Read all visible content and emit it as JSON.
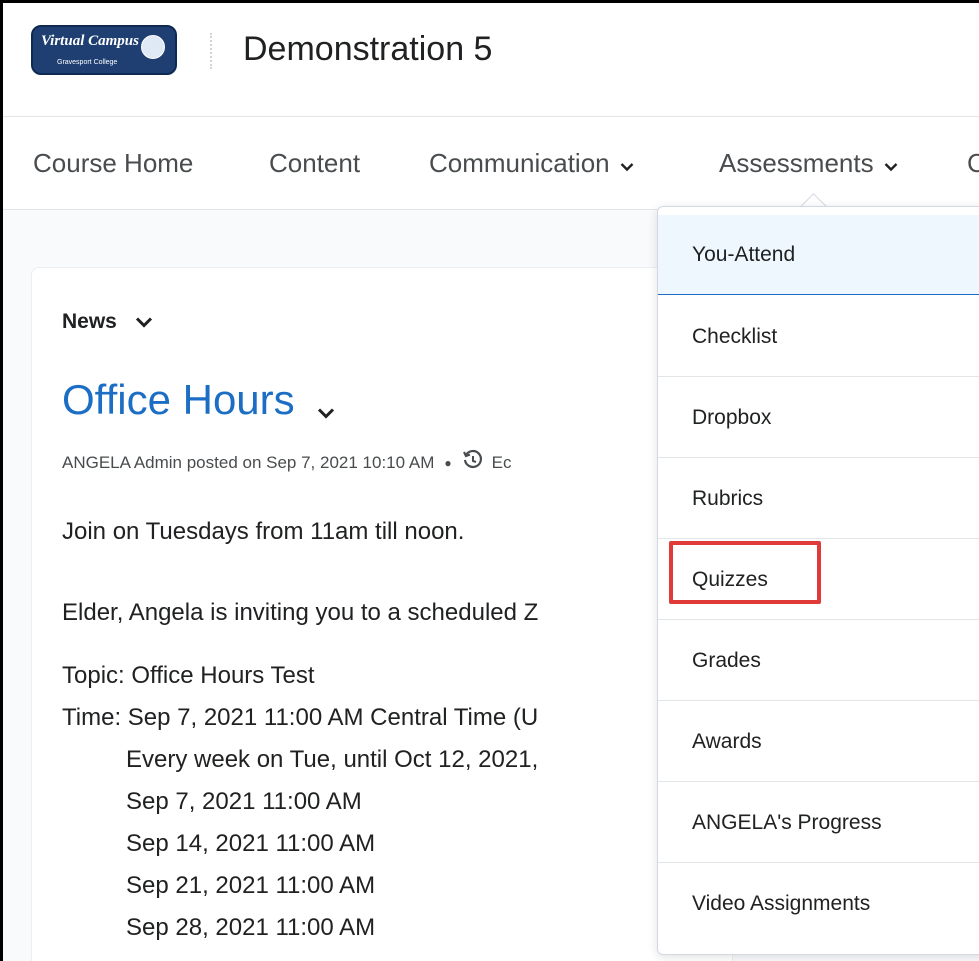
{
  "header": {
    "logo": {
      "text": "Virtual Campus",
      "subtext": "Gravesport College"
    },
    "course_title": "Demonstration 5"
  },
  "nav": {
    "items": [
      {
        "label": "Course Home",
        "has_dropdown": false
      },
      {
        "label": "Content",
        "has_dropdown": false
      },
      {
        "label": "Communication",
        "has_dropdown": true
      },
      {
        "label": "Assessments",
        "has_dropdown": true
      },
      {
        "label": "C",
        "has_dropdown": false
      }
    ]
  },
  "news": {
    "widget_label": "News",
    "title": "Office Hours",
    "posted_meta": "ANGELA Admin posted on Sep 7, 2021 10:10 AM",
    "edited_fragment": "Ec",
    "lines": [
      "Join on Tuesdays from 11am till noon.",
      "Elder, Angela is inviting you to a scheduled Z",
      "Topic: Office Hours Test",
      "Time: Sep 7, 2021 11:00 AM Central Time (U",
      "Every week on Tue, until Oct 12, 2021,",
      "Sep 7, 2021 11:00 AM",
      "Sep 14, 2021 11:00 AM",
      "Sep 21, 2021 11:00 AM",
      "Sep 28, 2021 11:00 AM"
    ]
  },
  "assessments_menu": {
    "items": [
      {
        "label": "You-Attend",
        "active": true
      },
      {
        "label": "Checklist"
      },
      {
        "label": "Dropbox"
      },
      {
        "label": "Rubrics"
      },
      {
        "label": "Quizzes",
        "highlighted": true
      },
      {
        "label": "Grades"
      },
      {
        "label": "Awards"
      },
      {
        "label": "ANGELA's Progress"
      },
      {
        "label": "Video Assignments"
      }
    ]
  },
  "colors": {
    "link_blue": "#1c6ec4",
    "highlight_red": "#e03a3a",
    "active_bg": "#eef7fd"
  }
}
